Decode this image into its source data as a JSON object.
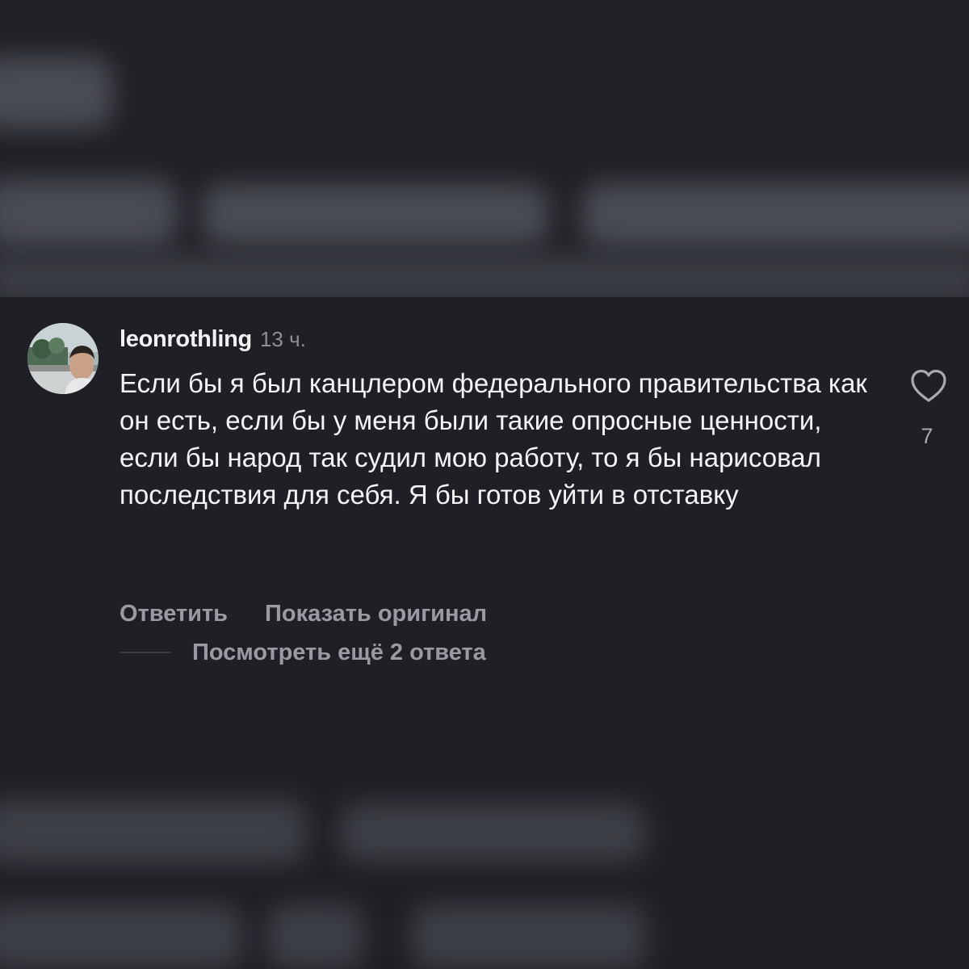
{
  "comment": {
    "username": "leonrothling",
    "time": "13 ч.",
    "text": "Если бы я был канцлером федерального правительства как он есть, если бы у меня были такие опросные ценности, если бы народ так судил мою работу, то я бы нарисовал последствия для себя. Я бы готов уйти в отставку",
    "like_count": "7",
    "avatar_icon": "user-avatar-photo",
    "like_icon": "heart-outline-icon"
  },
  "actions": {
    "reply_label": "Ответить",
    "show_original_label": "Показать оригинал",
    "view_replies_label": "Посмотреть ещё 2 ответа"
  },
  "colors": {
    "background": "#1e2026",
    "text_primary": "#f4f4f6",
    "text_secondary": "#9a9ba2"
  }
}
